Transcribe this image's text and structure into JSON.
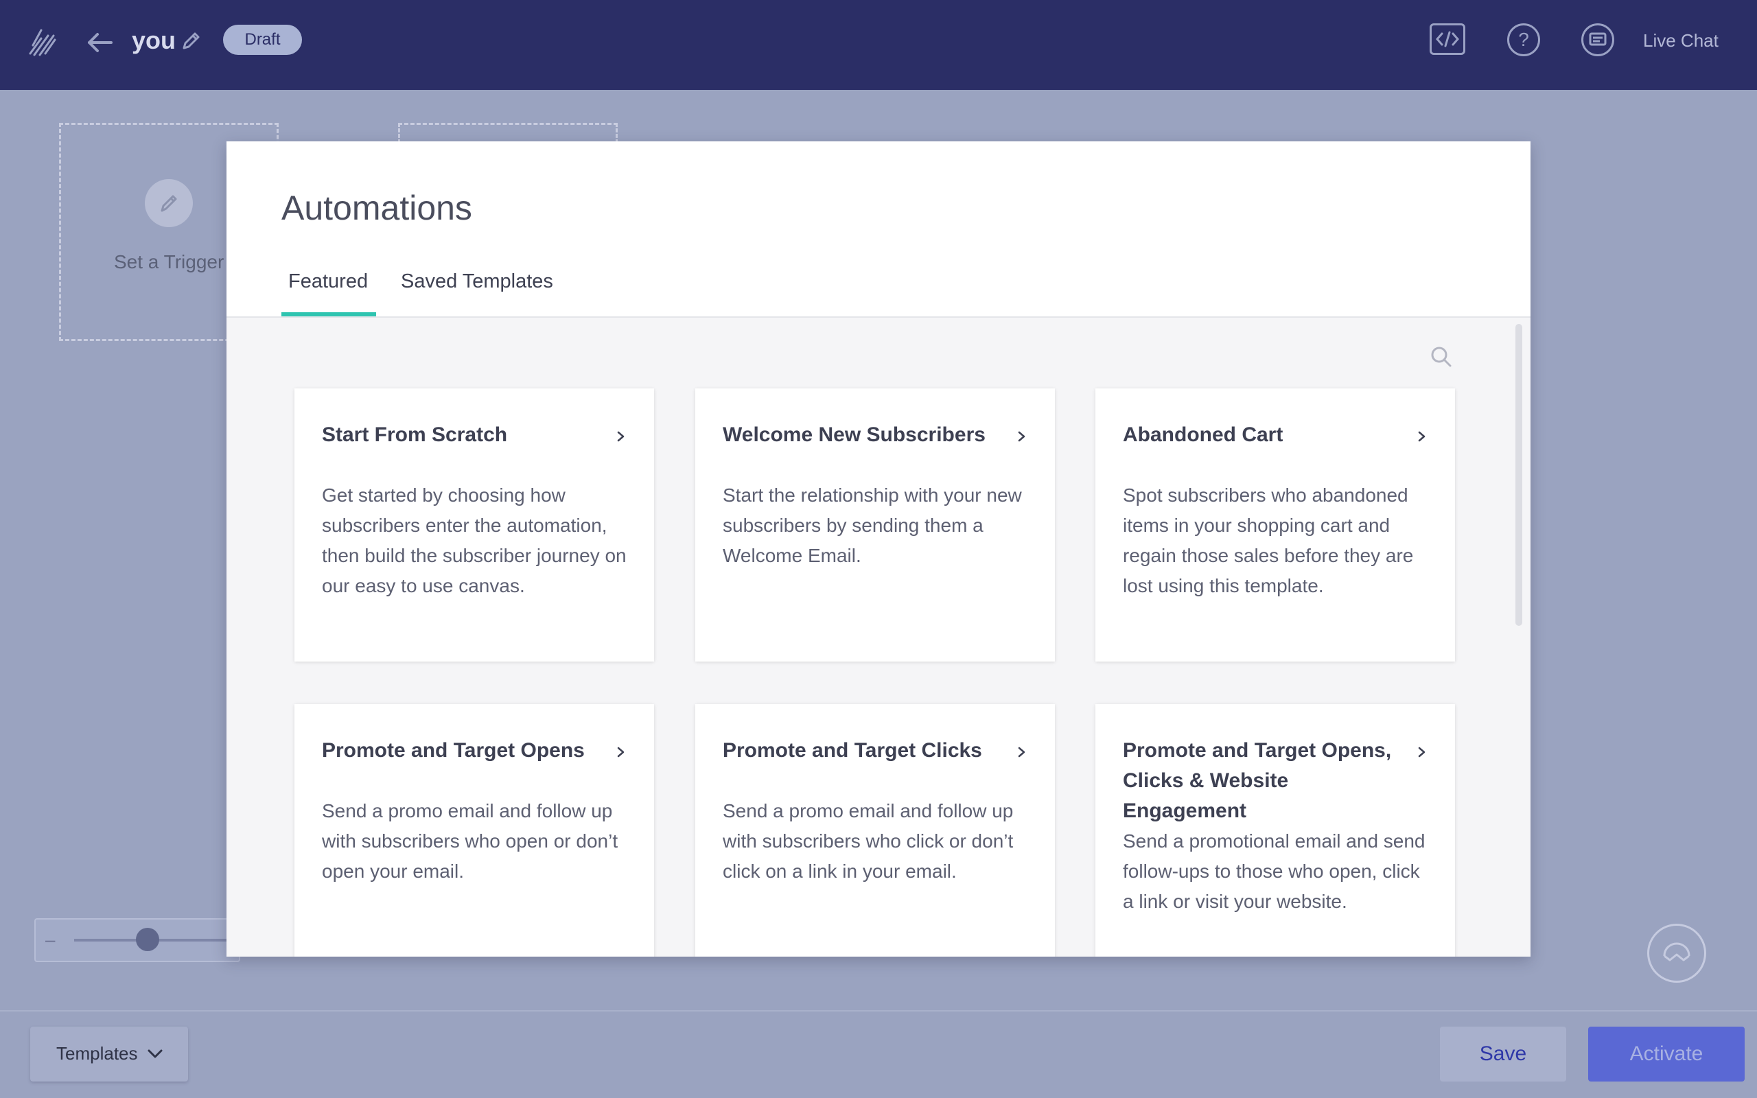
{
  "topbar": {
    "title": "you",
    "status_badge": "Draft",
    "live_chat_label": "Live Chat",
    "help_glyph": "?",
    "icons": [
      "logo-icon",
      "back-arrow-icon",
      "pencil-icon",
      "code-icon",
      "help-icon",
      "chat-icon"
    ]
  },
  "canvas": {
    "trigger_label": "Set a Trigger",
    "zoom_minus": "–"
  },
  "modal": {
    "title": "Automations",
    "tabs": [
      {
        "label": "Featured",
        "active": true
      },
      {
        "label": "Saved Templates",
        "active": false
      }
    ],
    "cards": [
      {
        "title": "Start From Scratch",
        "description": "Get started by choosing how subscribers enter the automation, then build the subscriber journey on our easy to use canvas."
      },
      {
        "title": "Welcome New Subscribers",
        "description": "Start the relationship with your new subscribers by sending them a Welcome Email."
      },
      {
        "title": "Abandoned Cart",
        "description": "Spot subscribers who abandoned items in your shopping cart and regain those sales before they are lost using this template."
      },
      {
        "title": "Promote and Target Opens",
        "description": "Send a promo email and follow up with subscribers who open or don’t open your email."
      },
      {
        "title": "Promote and Target Clicks",
        "description": "Send a promo email and follow up with subscribers who click or don’t click on a link in your email."
      },
      {
        "title": "Promote and Target Opens, Clicks & Website Engagement",
        "description": "Send a promotional email and send follow-ups to those who open, click a link or visit your website."
      }
    ]
  },
  "bottombar": {
    "templates_label": "Templates",
    "save_label": "Save",
    "activate_label": "Activate"
  },
  "colors": {
    "topbar": "#2b2e66",
    "accent_tab": "#2ec4b0",
    "activate": "#5a68d4",
    "overlay": "#9aa3c0"
  }
}
